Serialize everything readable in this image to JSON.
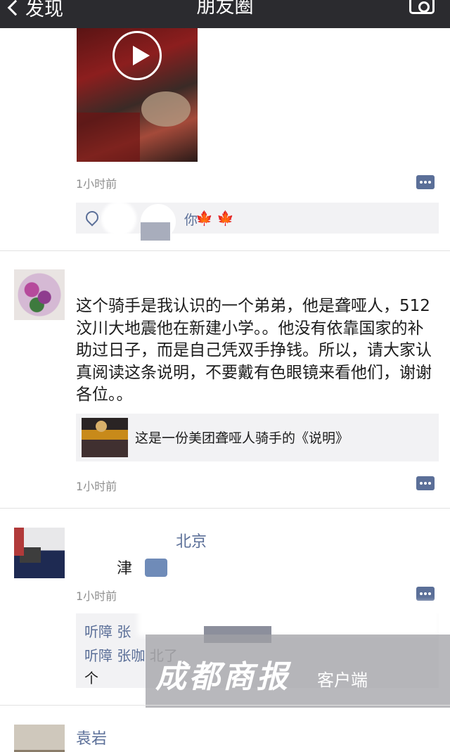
{
  "nav": {
    "back_label": "发现",
    "title": "朋友圈"
  },
  "posts": [
    {
      "time": "1小时前",
      "likes_text": "你"
    },
    {
      "text": "这个骑手是我认识的一个弟弟，他是聋哑人，512汶川大地震他在新建小学。。他没有依靠国家的补助过日子，而是自己凭双手挣钱。所以，请大家认真阅读这条说明，不要戴有色眼镜来看他们，谢谢各位。。",
      "link_title": "这是一份美团聋哑人骑手的《说明》",
      "time": "1小时前"
    },
    {
      "name_visible": "北京",
      "text_visible": "津",
      "time": "1小时前",
      "replies": [
        {
          "user": "听障 张",
          "text": ""
        },
        {
          "user": "听障 张咖",
          "text": "北了"
        },
        {
          "user": "",
          "text": "个"
        }
      ]
    },
    {
      "name": "袁岩"
    }
  ],
  "watermark": {
    "big": "成都商报",
    "small": "客户端"
  }
}
